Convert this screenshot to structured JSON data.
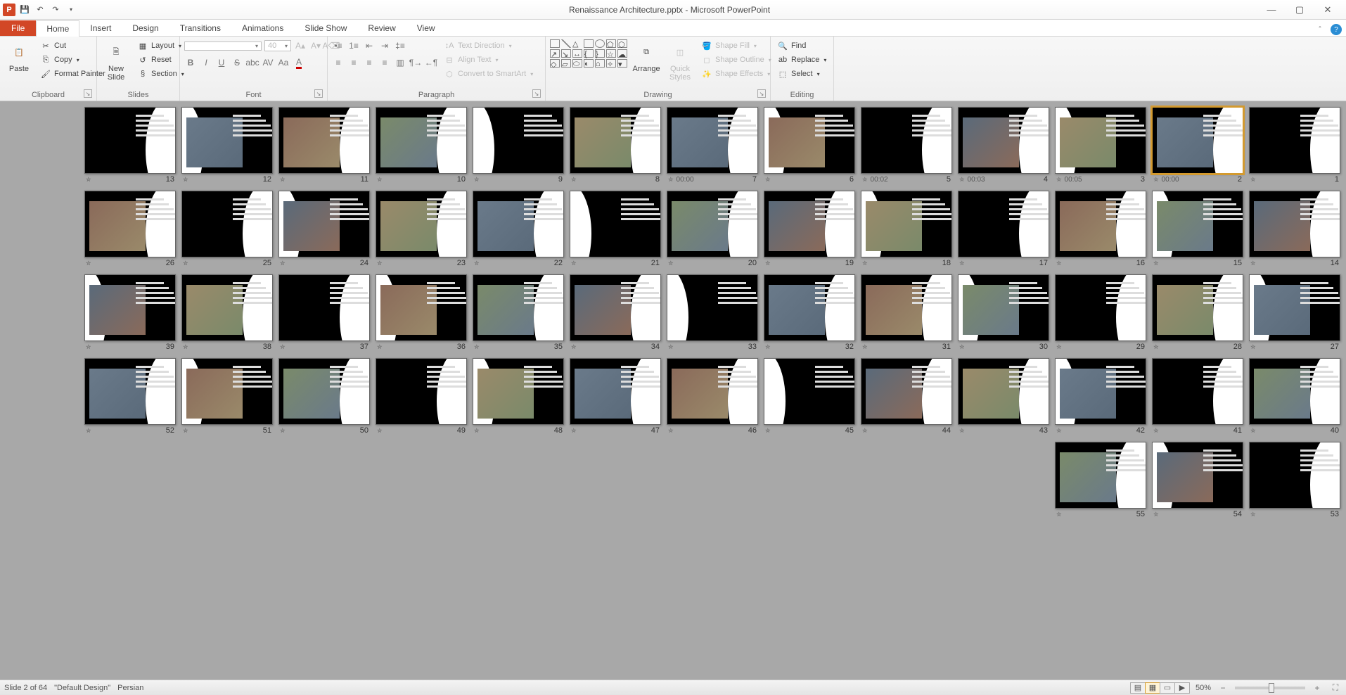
{
  "title": "Renaissance Architecture.pptx - Microsoft PowerPoint",
  "tabs": {
    "file": "File",
    "home": "Home",
    "insert": "Insert",
    "design": "Design",
    "transitions": "Transitions",
    "animations": "Animations",
    "slideshow": "Slide Show",
    "review": "Review",
    "view": "View"
  },
  "ribbon": {
    "clipboard": {
      "label": "Clipboard",
      "paste": "Paste",
      "cut": "Cut",
      "copy": "Copy",
      "format_painter": "Format Painter"
    },
    "slides": {
      "label": "Slides",
      "new_slide": "New\nSlide",
      "layout": "Layout",
      "reset": "Reset",
      "section": "Section"
    },
    "font": {
      "label": "Font",
      "size_placeholder": "40"
    },
    "paragraph": {
      "label": "Paragraph",
      "text_direction": "Text Direction",
      "align_text": "Align Text",
      "convert_smartart": "Convert to SmartArt"
    },
    "drawing": {
      "label": "Drawing",
      "arrange": "Arrange",
      "quick_styles": "Quick\nStyles",
      "shape_fill": "Shape Fill",
      "shape_outline": "Shape Outline",
      "shape_effects": "Shape Effects"
    },
    "editing": {
      "label": "Editing",
      "find": "Find",
      "replace": "Replace",
      "select": "Select"
    }
  },
  "slides": [
    {
      "n": 1,
      "time": ""
    },
    {
      "n": 2,
      "time": "00:00",
      "selected": true
    },
    {
      "n": 3,
      "time": "00:05"
    },
    {
      "n": 4,
      "time": "00:03"
    },
    {
      "n": 5,
      "time": "00:02"
    },
    {
      "n": 6,
      "time": ""
    },
    {
      "n": 7,
      "time": "00:00"
    },
    {
      "n": 8,
      "time": ""
    },
    {
      "n": 9,
      "time": ""
    },
    {
      "n": 10,
      "time": ""
    },
    {
      "n": 11,
      "time": ""
    },
    {
      "n": 12,
      "time": ""
    },
    {
      "n": 13,
      "time": ""
    },
    {
      "n": 14,
      "time": ""
    },
    {
      "n": 15,
      "time": ""
    },
    {
      "n": 16,
      "time": ""
    },
    {
      "n": 17,
      "time": ""
    },
    {
      "n": 18,
      "time": ""
    },
    {
      "n": 19,
      "time": ""
    },
    {
      "n": 20,
      "time": ""
    },
    {
      "n": 21,
      "time": ""
    },
    {
      "n": 22,
      "time": ""
    },
    {
      "n": 23,
      "time": ""
    },
    {
      "n": 24,
      "time": ""
    },
    {
      "n": 25,
      "time": ""
    },
    {
      "n": 26,
      "time": ""
    },
    {
      "n": 27,
      "time": ""
    },
    {
      "n": 28,
      "time": ""
    },
    {
      "n": 29,
      "time": ""
    },
    {
      "n": 30,
      "time": ""
    },
    {
      "n": 31,
      "time": ""
    },
    {
      "n": 32,
      "time": ""
    },
    {
      "n": 33,
      "time": ""
    },
    {
      "n": 34,
      "time": ""
    },
    {
      "n": 35,
      "time": ""
    },
    {
      "n": 36,
      "time": ""
    },
    {
      "n": 37,
      "time": ""
    },
    {
      "n": 38,
      "time": ""
    },
    {
      "n": 39,
      "time": ""
    },
    {
      "n": 40,
      "time": ""
    },
    {
      "n": 41,
      "time": ""
    },
    {
      "n": 42,
      "time": ""
    },
    {
      "n": 43,
      "time": ""
    },
    {
      "n": 44,
      "time": ""
    },
    {
      "n": 45,
      "time": ""
    },
    {
      "n": 46,
      "time": ""
    },
    {
      "n": 47,
      "time": ""
    },
    {
      "n": 48,
      "time": ""
    },
    {
      "n": 49,
      "time": ""
    },
    {
      "n": 50,
      "time": ""
    },
    {
      "n": 51,
      "time": ""
    },
    {
      "n": 52,
      "time": ""
    },
    {
      "n": 53,
      "time": ""
    },
    {
      "n": 54,
      "time": ""
    },
    {
      "n": 55,
      "time": ""
    }
  ],
  "status": {
    "slide_pos": "Slide 2 of 64",
    "theme": "\"Default Design\"",
    "language": "Persian",
    "zoom": "50%"
  }
}
